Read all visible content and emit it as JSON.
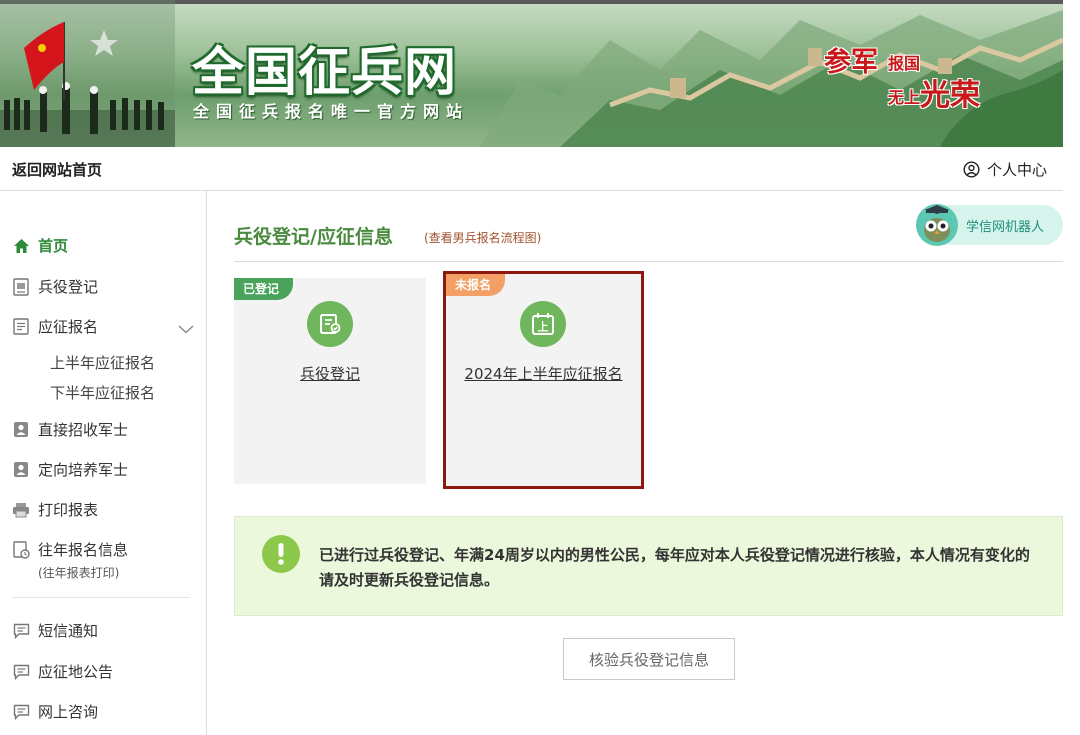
{
  "banner": {
    "title": "全国征兵网",
    "subtitle": "全国征兵报名唯一官方网站",
    "slogan": {
      "part1": "参军",
      "part2": "报国",
      "part3": "无上",
      "part4": "光荣"
    }
  },
  "topnav": {
    "back_home": "返回网站首页",
    "user_center": "个人中心"
  },
  "sidebar": {
    "items": [
      {
        "label": "首页",
        "icon": "home-icon",
        "active": true
      },
      {
        "label": "兵役登记",
        "icon": "document-icon"
      },
      {
        "label": "应征报名",
        "icon": "form-icon"
      },
      {
        "label": "直接招收军士",
        "icon": "id-card-icon"
      },
      {
        "label": "定向培养军士",
        "icon": "id-card-icon"
      },
      {
        "label": "打印报表",
        "icon": "printer-icon"
      },
      {
        "label": "往年报名信息",
        "icon": "history-icon",
        "note": "(往年报表打印)"
      },
      {
        "label": "短信通知",
        "icon": "message-icon"
      },
      {
        "label": "应征地公告",
        "icon": "message-icon"
      },
      {
        "label": "网上咨询",
        "icon": "message-icon"
      }
    ],
    "subitems": [
      "上半年应征报名",
      "下半年应征报名"
    ]
  },
  "main": {
    "title": "兵役登记/应征信息",
    "flow_link": "(查看男兵报名流程图)",
    "robot_label": "学信网机器人",
    "cards": [
      {
        "tag": "已登记",
        "label": "兵役登记",
        "icon": "registration-icon"
      },
      {
        "tag": "未报名",
        "label": "2024年上半年应征报名",
        "icon": "calendar-icon",
        "calendar_char": "上"
      }
    ],
    "notice": "已进行过兵役登记、年满24周岁以内的男性公民，每年应对本人兵役登记情况进行核验，本人情况有变化的请及时更新兵役登记信息。",
    "verify_button": "核验兵役登记信息"
  },
  "colors": {
    "accent_green": "#4a8a3f",
    "active_menu": "#2e8b3a",
    "registered_tag": "#4aa35a",
    "unregistered_tag": "#f2a066",
    "highlight_border": "#8a1a10",
    "notice_bg": "#ecf8dc"
  }
}
